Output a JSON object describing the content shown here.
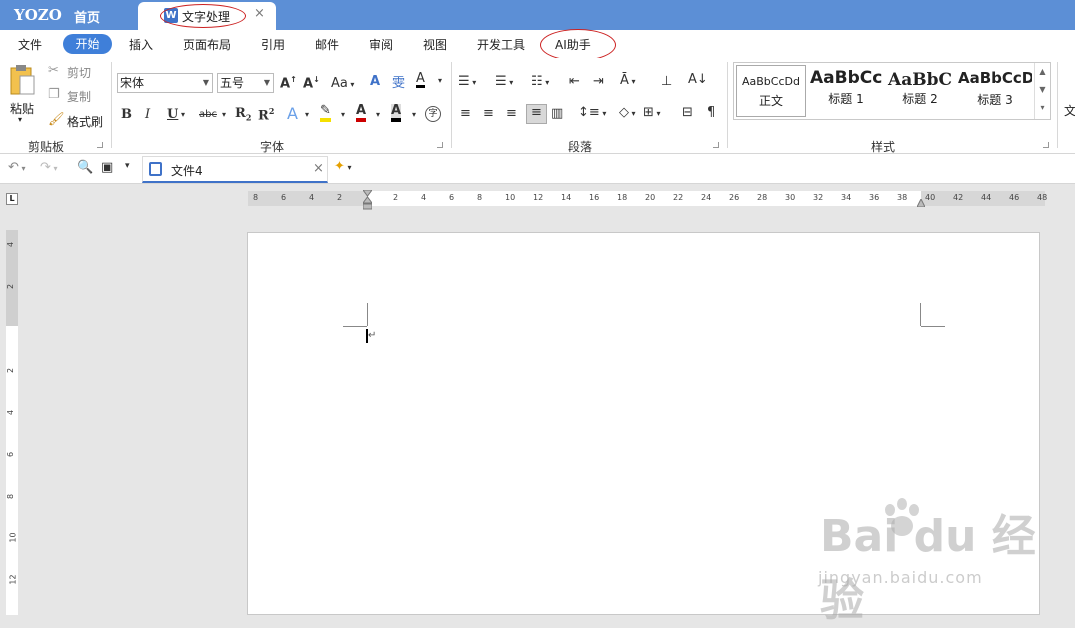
{
  "titlebar": {
    "brand": "YOZO",
    "home": "首页",
    "doc_tab": "文字处理",
    "doc_icon": "W",
    "close": "×"
  },
  "menu": {
    "items": [
      "文件",
      "开始",
      "插入",
      "页面布局",
      "引用",
      "邮件",
      "审阅",
      "视图",
      "开发工具",
      "AI助手"
    ]
  },
  "ribbon": {
    "clipboard": {
      "paste": "粘贴",
      "cut": "剪切",
      "copy": "复制",
      "format_painter": "格式刷",
      "group": "剪贴板"
    },
    "font": {
      "font_name": "宋体",
      "font_size": "五号",
      "case": "Aa",
      "phonetic": "wén",
      "bold": "B",
      "italic": "I",
      "underline": "U",
      "strike": "abc",
      "subscript": "R",
      "superscript": "R",
      "circle": "字",
      "group": "字体"
    },
    "paragraph": {
      "group": "段落"
    },
    "styles": {
      "items": [
        {
          "preview": "AaBbCcDd",
          "name": "正文"
        },
        {
          "preview": "AaBbCc",
          "name": "标题 1"
        },
        {
          "preview": "AaBbC",
          "name": "标题 2"
        },
        {
          "preview": "AaBbCcD",
          "name": "标题 3"
        }
      ],
      "group": "样式",
      "more": "文"
    }
  },
  "quickbar": {
    "file_tab": "文件4"
  },
  "ruler": {
    "h_labels": [
      "8",
      "6",
      "4",
      "2",
      "",
      "2",
      "4",
      "6",
      "8",
      "10",
      "12",
      "14",
      "16",
      "18",
      "20",
      "22",
      "24",
      "26",
      "28",
      "30",
      "32",
      "34",
      "36",
      "38",
      "40",
      "42",
      "44",
      "46",
      "48"
    ],
    "v_labels": [
      "4",
      "2",
      "",
      "2",
      "4",
      "6",
      "8",
      "10",
      "12"
    ],
    "corner": "L"
  },
  "watermark": {
    "brand": "Bai du 经验",
    "sub": "jingyan.baidu.com"
  },
  "colors": {
    "accent": "#3f7fd9",
    "titlebar": "#5c8fd6",
    "annotation": "#cc2222"
  }
}
